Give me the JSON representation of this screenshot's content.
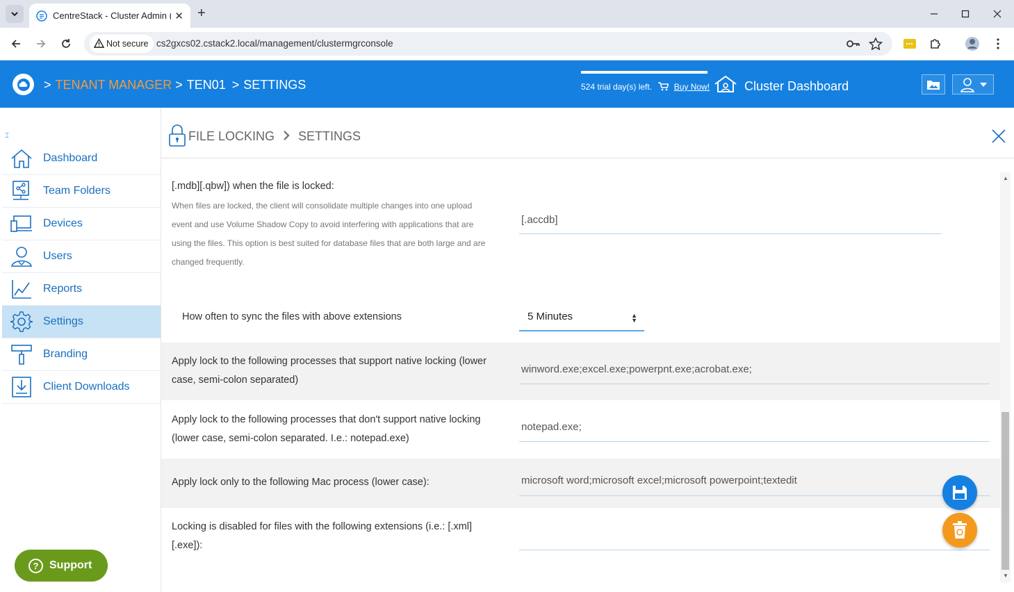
{
  "browser": {
    "tab_title": "CentreStack - Cluster Admin (j",
    "security_label": "Not secure",
    "url": "cs2gxcs02.cstack2.local/management/clustermgrconsole"
  },
  "header": {
    "breadcrumbs": [
      {
        "label": "TENANT MANAGER",
        "link": true
      },
      {
        "label": "TEN01",
        "link": false
      },
      {
        "label": "SETTINGS",
        "link": false
      }
    ],
    "sep": ">",
    "trial_text": "524 trial day(s) left.",
    "buy_now": "Buy Now!",
    "cluster_dashboard": "Cluster Dashboard"
  },
  "sidebar": {
    "items": [
      {
        "label": "Dashboard",
        "icon": "home-icon"
      },
      {
        "label": "Team Folders",
        "icon": "team-folders-icon"
      },
      {
        "label": "Devices",
        "icon": "devices-icon"
      },
      {
        "label": "Users",
        "icon": "users-icon"
      },
      {
        "label": "Reports",
        "icon": "reports-icon"
      },
      {
        "label": "Settings",
        "icon": "settings-icon",
        "active": true
      },
      {
        "label": "Branding",
        "icon": "branding-icon"
      },
      {
        "label": "Client Downloads",
        "icon": "download-icon"
      }
    ],
    "support": "Support"
  },
  "panel": {
    "title": "FILE LOCKING",
    "subtitle": "SETTINGS"
  },
  "settings": {
    "partial_label": "[.mdb][.qbw]) when the file is locked:",
    "partial_desc_lines": [
      "When files are locked, the client will consolidate multiple changes into one upload",
      "event and use Volume Shadow Copy to avoid interfering with applications that are",
      "using the files. This option is best suited for database files that are both large and are",
      "changed frequently."
    ],
    "extensions_value": "[.accdb]",
    "sync_label": "How often to sync the files with above extensions",
    "sync_value": "5 Minutes",
    "native_label_lines": [
      "Apply lock to the following processes that support native locking (lower",
      "case, semi-colon separated)"
    ],
    "native_value": "winword.exe;excel.exe;powerpnt.exe;acrobat.exe;",
    "nonnative_label_lines": [
      "Apply lock to the following processes that don't support native locking",
      "(lower case, semi-colon separated. I.e.: notepad.exe)"
    ],
    "nonnative_value": "notepad.exe;",
    "mac_label": "Apply lock only to the following Mac process (lower case):",
    "mac_value": "microsoft word;microsoft excel;microsoft powerpoint;textedit",
    "disabled_label_lines": [
      "Locking is disabled for files with the following extensions (i.e.: [.xml]",
      "[.exe]):"
    ],
    "disabled_value": ""
  },
  "colors": {
    "brand_blue": "#1580e0",
    "accent_orange": "#f19a3e",
    "support_green": "#6a9a1c",
    "active_nav": "#c7e1f5"
  }
}
